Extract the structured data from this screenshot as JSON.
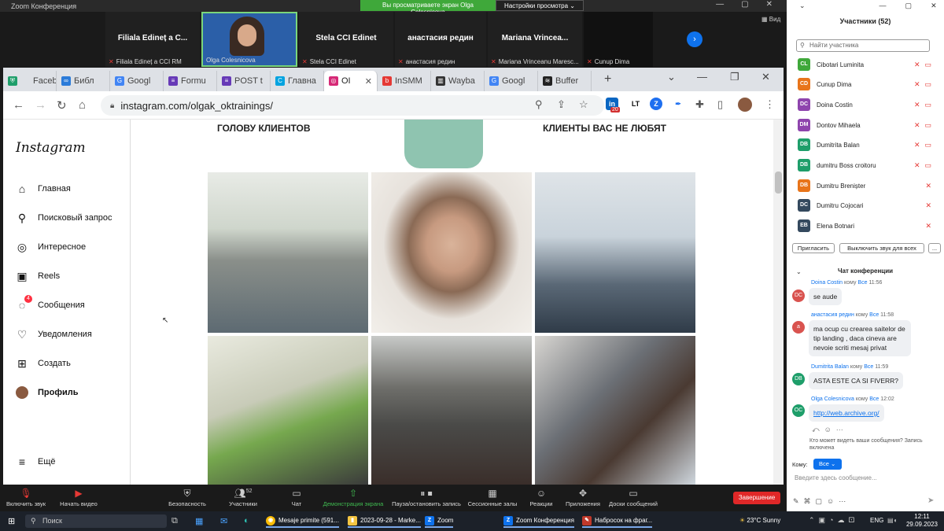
{
  "zoom": {
    "title": "Zoom Конференция",
    "share_banner": "Вы просматриваете экран Olga Colesnicova",
    "view_settings": "Настройки просмотра",
    "view_label": "Вид",
    "tiles": [
      {
        "name": "Filiala Edineț a C...",
        "caption": "Filiala Edineț a CCI RM"
      },
      {
        "name": "",
        "caption": "Olga Colesnicova"
      },
      {
        "name": "Stela CCI Edinet",
        "caption": "Stela CCI Edinet"
      },
      {
        "name": "анастасия редин",
        "caption": "анастасия редин"
      },
      {
        "name": "Mariana  Vrincea...",
        "caption": "Mariana Vrinceanu Maresc..."
      },
      {
        "name": "",
        "caption": "Cunup Dima"
      }
    ],
    "bottom_bar": {
      "mute": "Включить звук",
      "video": "Начать видео",
      "security": "Безопасность",
      "participants": "Участники",
      "participants_count": "52",
      "chat": "Чат",
      "share": "Демонстрация экрана",
      "pause": "Пауза/остановить запись",
      "rooms": "Сессионные залы",
      "reactions": "Реакции",
      "apps": "Приложения",
      "docs": "Доски сообщений",
      "end": "Завершение"
    }
  },
  "browser": {
    "tabs": [
      {
        "label": "Faceb",
        "color": "#1877f2",
        "glyph": "f"
      },
      {
        "label": "Библ",
        "color": "#2b7bd9",
        "glyph": "∞"
      },
      {
        "label": "Googl",
        "color": "#4285f4",
        "glyph": "G"
      },
      {
        "label": "Formu",
        "color": "#673ab7",
        "glyph": "≡"
      },
      {
        "label": "POST t",
        "color": "#673ab7",
        "glyph": "≡"
      },
      {
        "label": "Главна",
        "color": "#00a3e0",
        "glyph": "C"
      },
      {
        "label": "OI",
        "color": "#d62976",
        "glyph": "◎",
        "active": true
      },
      {
        "label": "InSMM",
        "color": "#e53935",
        "glyph": "b"
      },
      {
        "label": "Wayba",
        "color": "#333333",
        "glyph": "▥"
      },
      {
        "label": "Googl",
        "color": "#4285f4",
        "glyph": "G"
      },
      {
        "label": "Buffer",
        "color": "#222222",
        "glyph": "≋"
      }
    ],
    "url": "instagram.com/olgak_oktrainings/",
    "ext_badge": "20"
  },
  "instagram": {
    "logo": "Instagram",
    "nav": [
      {
        "label": "Главная",
        "icon": "home-icon",
        "glyph": "⌂"
      },
      {
        "label": "Поисковый запрос",
        "icon": "search-icon",
        "glyph": "⚲"
      },
      {
        "label": "Интересное",
        "icon": "compass-icon",
        "glyph": "◎"
      },
      {
        "label": "Reels",
        "icon": "reels-icon",
        "glyph": "▣"
      },
      {
        "label": "Сообщения",
        "icon": "messenger-icon",
        "glyph": "◌",
        "badge": "4"
      },
      {
        "label": "Уведомления",
        "icon": "heart-icon",
        "glyph": "♡"
      },
      {
        "label": "Создать",
        "icon": "plus-square-icon",
        "glyph": "⊞"
      },
      {
        "label": "Профиль",
        "icon": "avatar-icon",
        "glyph": "●"
      }
    ],
    "more": "Ещё",
    "caption_left": "ГОЛОВУ КЛИЕНТОВ",
    "caption_right": "КЛИЕНТЫ ВАС НЕ ЛЮБЯТ"
  },
  "participants": {
    "title": "Участники (52)",
    "search_placeholder": "Найти участника",
    "list": [
      {
        "initials": "CL",
        "name": "Cibotari Luminita",
        "color": "#3fa83a"
      },
      {
        "initials": "CD",
        "name": "Cunup Dima",
        "color": "#e8741a"
      },
      {
        "initials": "DC",
        "name": "Doina Costin",
        "color": "#8e44ad"
      },
      {
        "initials": "DM",
        "name": "Dontov Mihaela",
        "color": "#8e44ad"
      },
      {
        "initials": "DB",
        "name": "Dumitrita Balan",
        "color": "#1e9e6a"
      },
      {
        "initials": "DB",
        "name": "dumitru Boss croitoru",
        "color": "#1e9e6a"
      },
      {
        "initials": "DB",
        "name": "Dumitru Brenișter",
        "color": "#e8741a"
      },
      {
        "initials": "DC",
        "name": "Dumitru Cojocari",
        "color": "#34495e"
      },
      {
        "initials": "EB",
        "name": "Elena Botnari",
        "color": "#34495e"
      }
    ],
    "invite": "Пригласить",
    "mute_all": "Выключить звук для всех",
    "more": "..."
  },
  "chat": {
    "title": "Чат конференции",
    "messages": [
      {
        "sender": "Doina Costin",
        "to": "кому",
        "all": "Все",
        "time": "11:56",
        "text": "se aude",
        "initials": "DC",
        "color": "#d9534f"
      },
      {
        "sender": "анастасия редин",
        "to": "кому",
        "all": "Все",
        "time": "11:58",
        "text": "ma ocup cu crearea saitelor de tip landing , daca cineva are nevoie scriti mesaj privat",
        "initials": "a",
        "color": "#d9534f"
      },
      {
        "sender": "Dumitrita Balan",
        "to": "кому",
        "all": "Все",
        "time": "11:59",
        "text": "ASTA ESTE CA SI FIVERR?",
        "initials": "DB",
        "color": "#1e9e6a"
      },
      {
        "sender": "Olga Colesnicova",
        "to": "кому",
        "all": "Все",
        "time": "12:02",
        "text": "http://web.archive.org/",
        "initials": "OC",
        "color": "#1e9e6a",
        "link": true
      }
    ],
    "note": "Кто может видеть ваши сообщения? Запись включена",
    "to_label": "Кому:",
    "to_value": "Все",
    "input_placeholder": "Введите здесь сообщение..."
  },
  "taskbar": {
    "search": "Поиск",
    "apps": [
      {
        "label": "Mesaje primite (591...",
        "color": "#fbbc05",
        "glyph": "◉"
      },
      {
        "label": "2023-09-28 - Marke...",
        "color": "#f4c542",
        "glyph": "▮"
      },
      {
        "label": "Zoom",
        "color": "#0e72ed",
        "glyph": "Z"
      },
      {
        "label": "Zoom Конференция",
        "color": "#0e72ed",
        "glyph": "Z"
      },
      {
        "label": "Набросок на фраг...",
        "color": "#c0392b",
        "glyph": "✎"
      }
    ],
    "weather": "23°C  Sunny",
    "lang": "ENG",
    "time": "12:11",
    "date": "29.09.2023"
  }
}
